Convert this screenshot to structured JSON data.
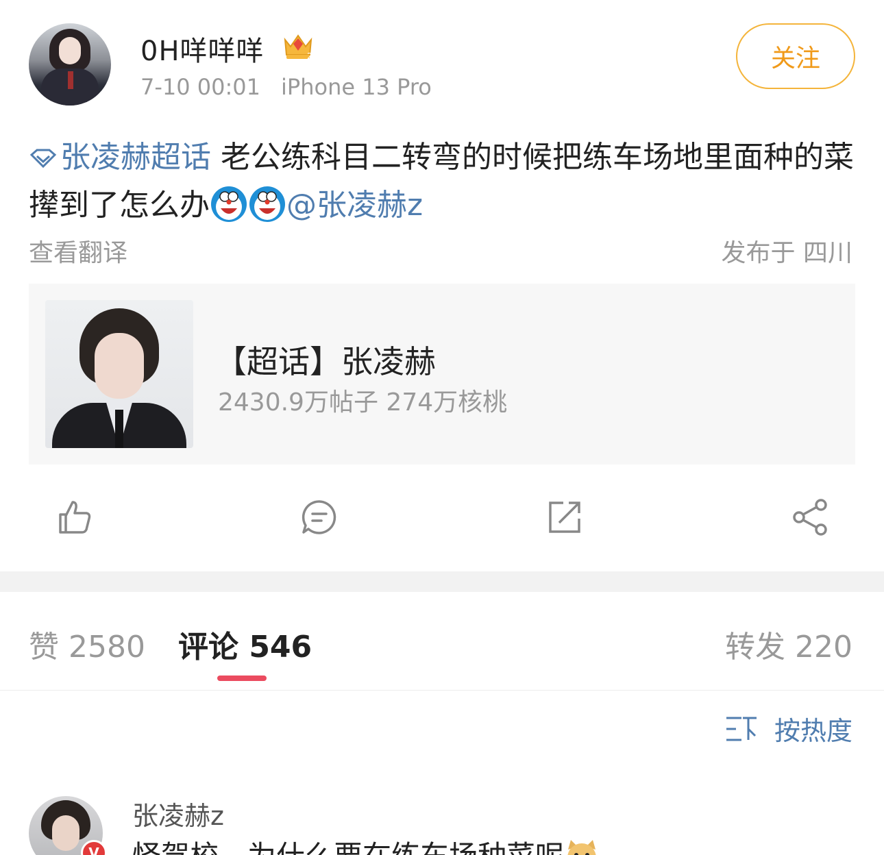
{
  "post": {
    "username": "0H咩咩咩",
    "time": "7-10 00:01",
    "device": "iPhone 13 Pro",
    "follow_label": "关注",
    "topic_link": "张凌赫超话",
    "body_text": "  老公练科目二转弯的时候把练车场地里面种的菜撵到了怎么办",
    "mention": "@张凌赫z",
    "translate_label": "查看翻译",
    "location": "发布于 四川"
  },
  "topic_card": {
    "title": "【超话】张凌赫",
    "stats": "2430.9万帖子 274万核桃"
  },
  "tabs": {
    "likes": "赞 2580",
    "comments": "评论 546",
    "reposts": "转发 220"
  },
  "sort": {
    "label": "按热度"
  },
  "comment": {
    "user": "张凌赫z",
    "text": "怪驾校，为什么要在练车场种菜呢",
    "badge": "V"
  },
  "colors": {
    "link": "#507daf",
    "follow": "#f09a1a",
    "tab_indicator": "#eb4b5f"
  }
}
